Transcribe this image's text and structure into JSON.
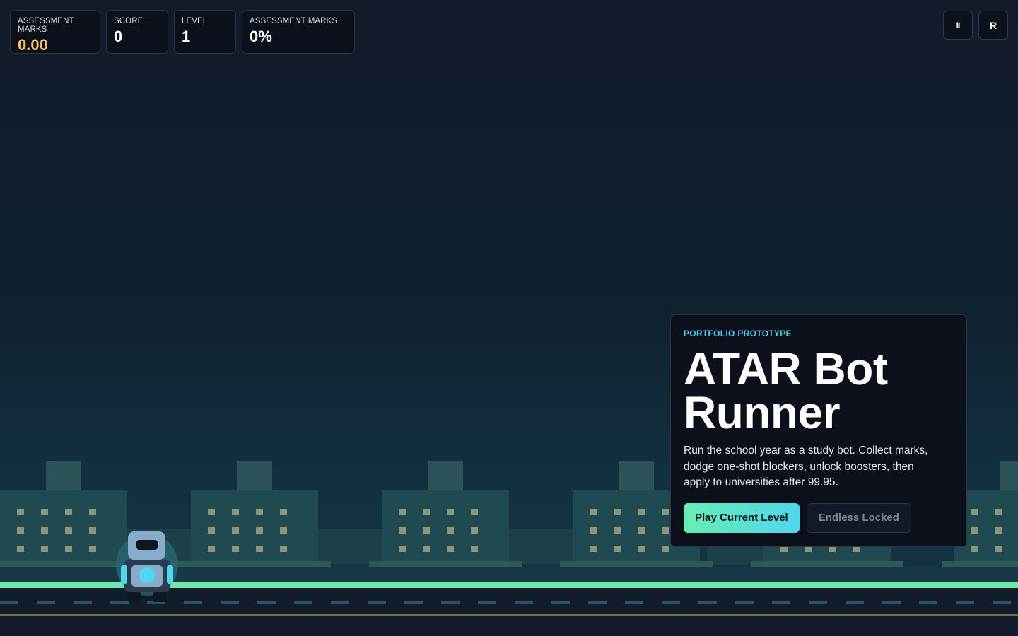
{
  "hud": {
    "stats": [
      {
        "label": "ASSESSMENT MARKS",
        "value": "0.00"
      },
      {
        "label": "SCORE",
        "value": "0"
      },
      {
        "label": "LEVEL",
        "value": "1"
      },
      {
        "label": "ASSESSMENT MARKS",
        "value": "0%"
      }
    ],
    "controls": {
      "pause_label": "II",
      "restart_label": "R"
    }
  },
  "panel": {
    "eyebrow": "PORTFOLIO PROTOTYPE",
    "title_line1": "ATAR Bot",
    "title_line2": "Runner",
    "description": "Run the school year as a study bot. Collect marks, dodge one-shot blockers, unlock boosters, then apply to universities after 99.95.",
    "play_label": "Play Current Level",
    "endless_label": "Endless Locked"
  },
  "colors": {
    "accent_gold": "#f6c15b",
    "accent_cyan": "#46d0ea",
    "accent_green": "#66eeb3",
    "ground_stripe": "#6ee9a8",
    "building": "#1f4a52",
    "window": "#8e9675"
  },
  "icons": {
    "pause": "pause-icon",
    "restart": "restart-icon",
    "player": "robot-icon"
  }
}
